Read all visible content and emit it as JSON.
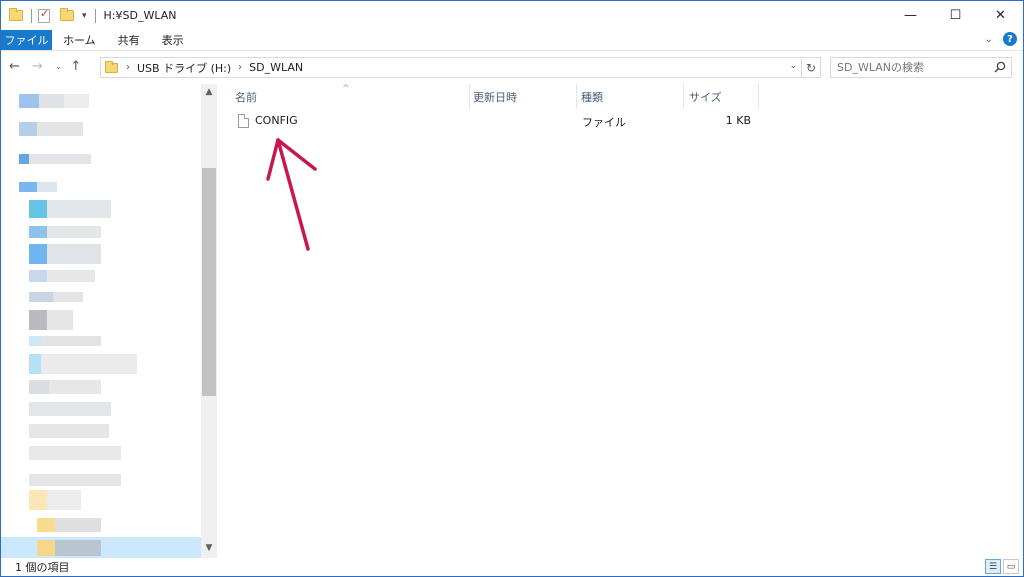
{
  "window": {
    "title": "H:¥SD_WLAN",
    "controls": {
      "minimize": "—",
      "maximize": "☐",
      "close": "✕"
    }
  },
  "ribbon": {
    "file_tab": "ファイル",
    "tabs": [
      "ホーム",
      "共有",
      "表示"
    ],
    "expand_glyph": "⌄",
    "help_glyph": "?"
  },
  "address": {
    "crumbs": [
      "USB ドライブ (H:)",
      "SD_WLAN"
    ],
    "separator": "›",
    "drop_glyph": "⌄",
    "refresh_glyph": "↻"
  },
  "search": {
    "placeholder": "SD_WLANの検索"
  },
  "nav_buttons": {
    "back": "←",
    "forward": "→",
    "recent": "⌄",
    "up": "↑"
  },
  "columns": {
    "name": "名前",
    "date": "更新日時",
    "type": "種類",
    "size": "サイズ",
    "sort_glyph": "^"
  },
  "files": [
    {
      "name": "CONFIG",
      "date": "",
      "type": "ファイル",
      "size": "1 KB"
    }
  ],
  "status": {
    "item_count": "1 個の項目"
  },
  "colors": {
    "accent": "#1979ca",
    "annotation_arrow": "#c8174e",
    "selection": "#cce8ff"
  },
  "icons": {
    "folder": "folder-icon",
    "file": "file-icon",
    "search": "search-icon",
    "arrow": "annotation-arrow"
  }
}
